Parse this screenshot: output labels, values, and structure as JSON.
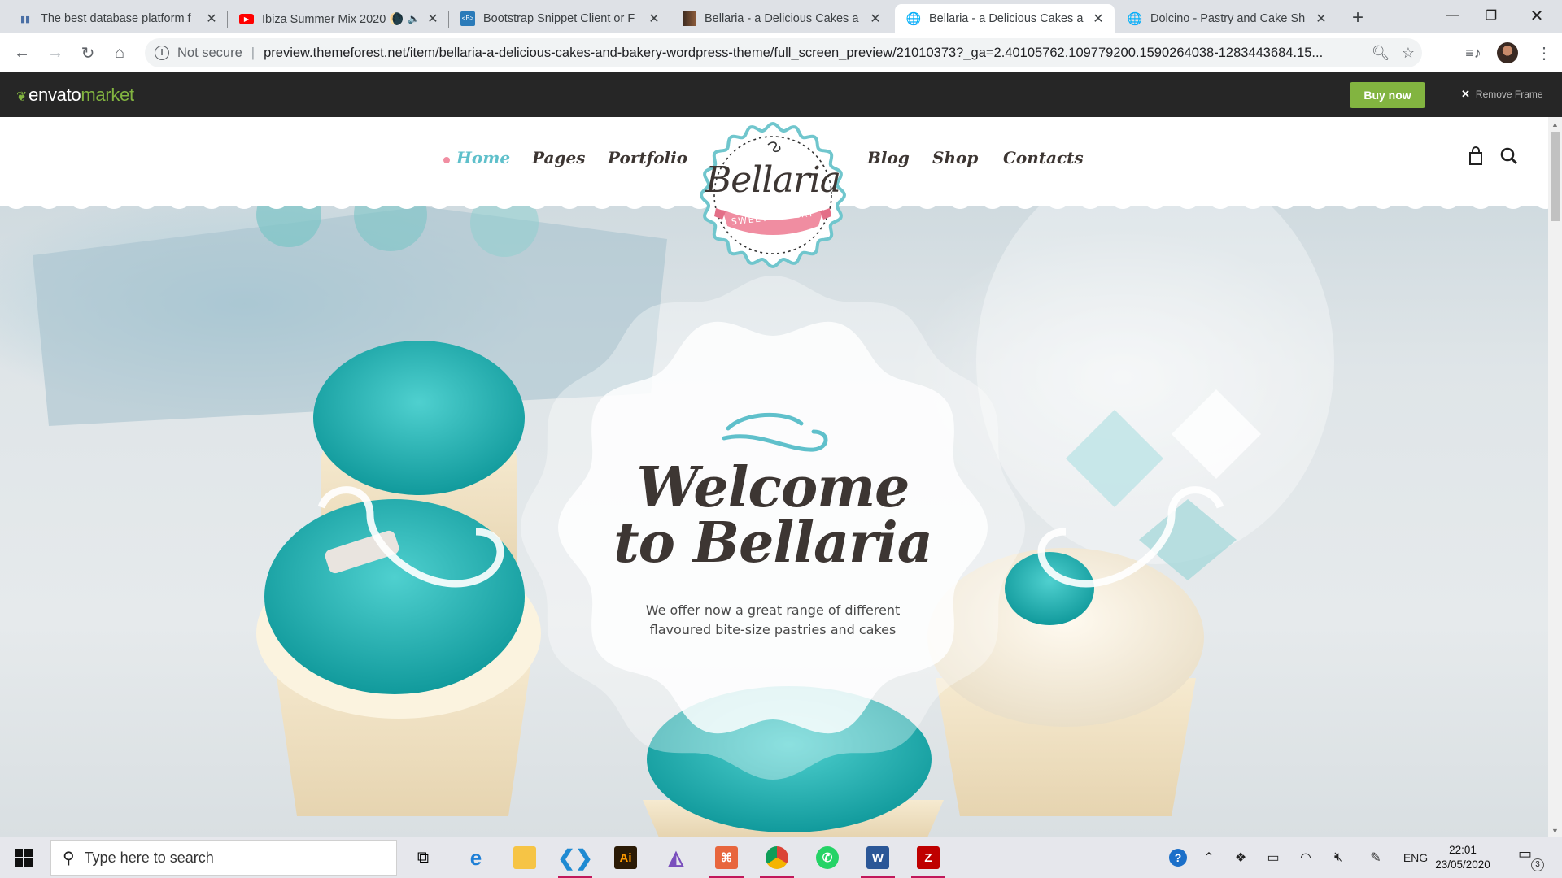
{
  "browser": {
    "tabs": [
      {
        "title": "The best database platform f",
        "icon": "db-favicon"
      },
      {
        "title": "Ibiza Summer Mix 2020 🌘",
        "icon": "youtube-favicon"
      },
      {
        "title": "Bootstrap Snippet Client or F",
        "icon": "bootsnipp-favicon"
      },
      {
        "title": "Bellaria - a Delicious Cakes a",
        "icon": "themeforest-favicon"
      },
      {
        "title": "Bellaria - a Delicious Cakes a",
        "icon": "globe-favicon",
        "active": true
      },
      {
        "title": "Dolcino - Pastry and Cake Sh",
        "icon": "globe-favicon"
      }
    ],
    "security_label": "Not secure",
    "url": "preview.themeforest.net/item/bellaria-a-delicious-cakes-and-bakery-wordpress-theme/full_screen_preview/21010373?_ga=2.40105762.109779200.1590264038-1283443684.15..."
  },
  "envato": {
    "logo_main": "envato",
    "logo_accent": "market",
    "buy_now": "Buy now",
    "remove_frame": "Remove Frame"
  },
  "site": {
    "nav": {
      "home": "Home",
      "pages": "Pages",
      "portfolio": "Portfolio",
      "blog": "Blog",
      "shop": "Shop",
      "contacts": "Contacts"
    },
    "logo": {
      "name": "Bellaria",
      "subtitle": "SWEET BAKERY"
    },
    "hero": {
      "title_line1": "Welcome",
      "title_line2": "to Bellaria",
      "tagline_line1": "We offer now a great range of different",
      "tagline_line2": "flavoured bite-size pastries and cakes"
    }
  },
  "taskbar": {
    "search_placeholder": "Type here to search",
    "language": "ENG",
    "time": "22:01",
    "date": "23/05/2020",
    "notification_count": "3"
  },
  "colors": {
    "accent_teal": "#5fc0cb",
    "envato_green": "#82b440",
    "pink_ribbon": "#f08da1",
    "text_brown": "#3d3633"
  }
}
